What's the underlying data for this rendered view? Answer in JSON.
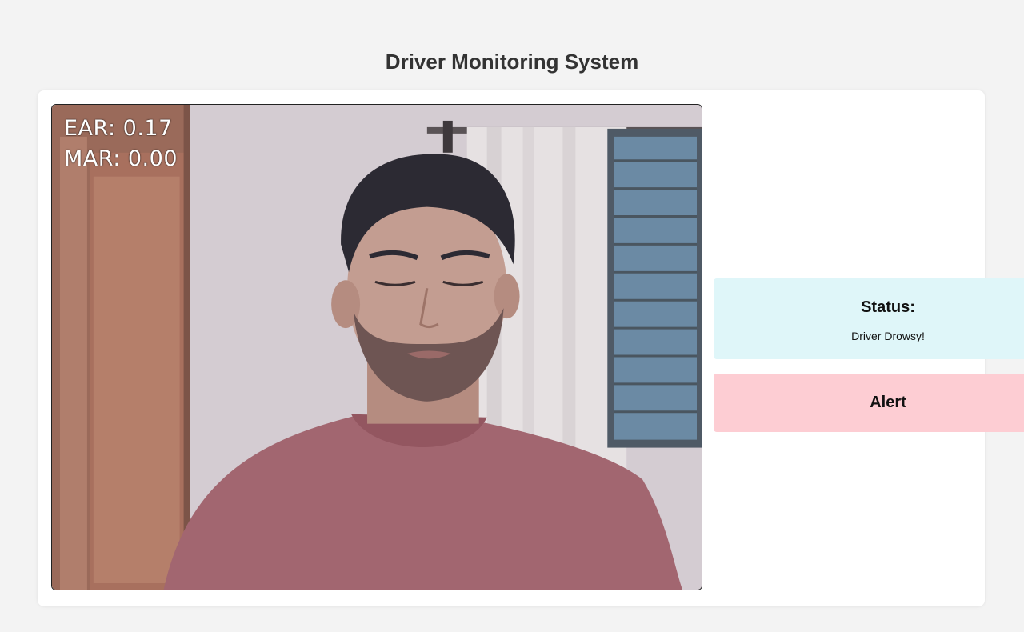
{
  "page": {
    "title": "Driver Monitoring System"
  },
  "video": {
    "ear_text": "EAR: 0.17",
    "mar_text": "MAR: 0.00"
  },
  "status": {
    "heading": "Status:",
    "message": "Driver Drowsy!"
  },
  "alert": {
    "label": "Alert"
  },
  "colors": {
    "background": "#f3f3f3",
    "card": "#ffffff",
    "status_bg": "#dff6f9",
    "alert_bg": "#fdcdd3"
  }
}
